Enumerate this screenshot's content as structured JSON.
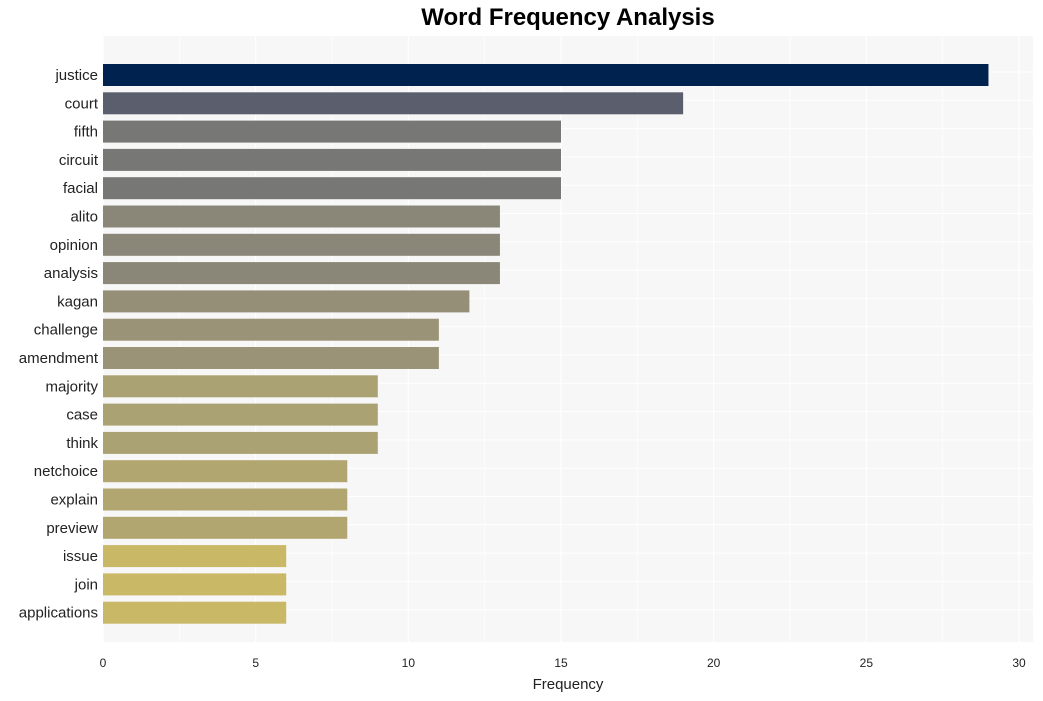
{
  "chart_data": {
    "type": "bar",
    "orientation": "horizontal",
    "title": "Word Frequency Analysis",
    "xlabel": "Frequency",
    "ylabel": "",
    "xlim": [
      0,
      30.5
    ],
    "xticks": [
      0,
      5,
      10,
      15,
      20,
      25,
      30
    ],
    "grid": true,
    "categories": [
      "justice",
      "court",
      "fifth",
      "circuit",
      "facial",
      "alito",
      "opinion",
      "analysis",
      "kagan",
      "challenge",
      "amendment",
      "majority",
      "case",
      "think",
      "netchoice",
      "explain",
      "preview",
      "issue",
      "join",
      "applications"
    ],
    "values": [
      29,
      19,
      15,
      15,
      15,
      13,
      13,
      13,
      12,
      11,
      11,
      9,
      9,
      9,
      8,
      8,
      8,
      6,
      6,
      6
    ],
    "colors": [
      "#00224e",
      "#5b5f6d",
      "#777776",
      "#777776",
      "#777776",
      "#8a8678",
      "#8a8678",
      "#8a8678",
      "#958f78",
      "#9b9377",
      "#9b9377",
      "#aba274",
      "#aba274",
      "#aba274",
      "#b2a670",
      "#b2a670",
      "#b2a670",
      "#c9b866",
      "#c9b866",
      "#c9b866"
    ]
  }
}
